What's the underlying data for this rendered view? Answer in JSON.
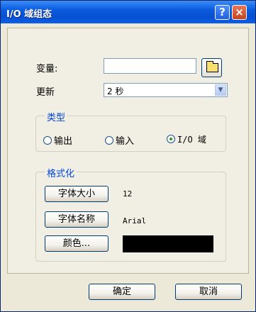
{
  "window": {
    "title": "I/O 域组态",
    "help_glyph": "?",
    "close_glyph": "×"
  },
  "variable": {
    "label": "变量:",
    "value": ""
  },
  "update": {
    "label": "更新",
    "selected": "2 秒",
    "arrow": "▼"
  },
  "type_group": {
    "title": "类型",
    "options": [
      {
        "label": "输出",
        "selected": false
      },
      {
        "label": "输入",
        "selected": false
      },
      {
        "label": "I/O 域",
        "selected": true
      }
    ]
  },
  "format_group": {
    "title": "格式化",
    "font_size_button": "字体大小",
    "font_size_value": "12",
    "font_name_button": "字体名称",
    "font_name_value": "Arial",
    "color_button": "颜色...",
    "color_value": "#000000"
  },
  "footer": {
    "ok": "确定",
    "cancel": "取消"
  }
}
